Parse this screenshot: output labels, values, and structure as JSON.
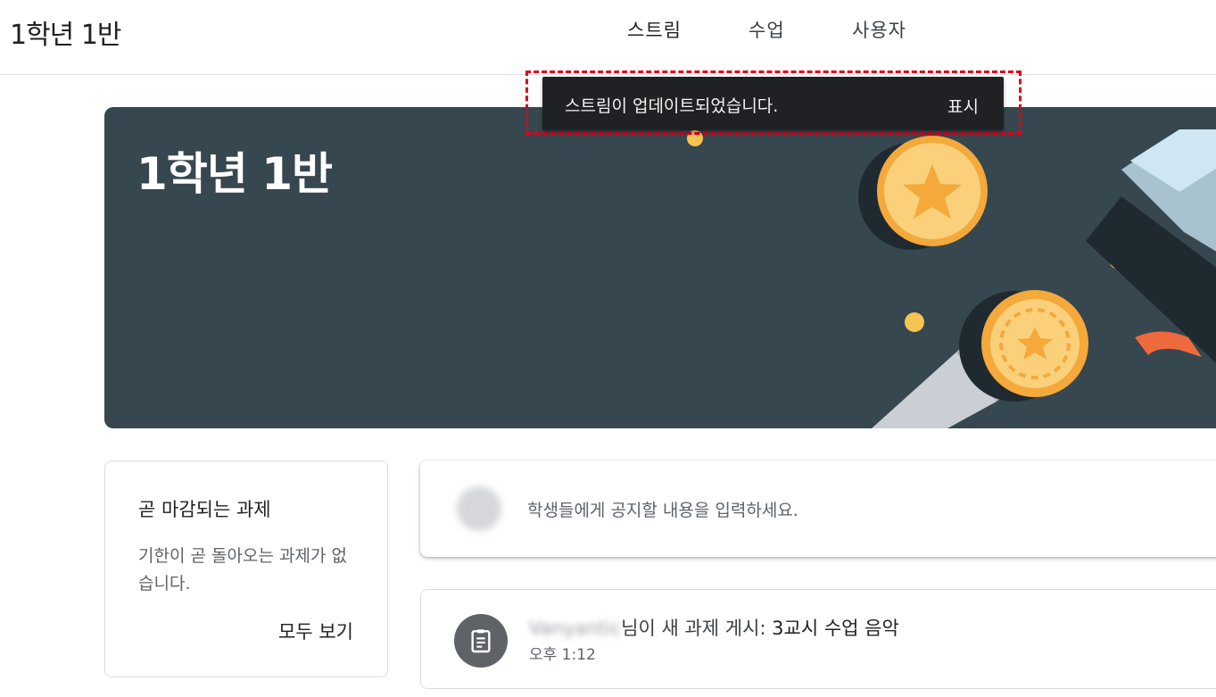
{
  "header": {
    "class_name": "1학년 1반",
    "tabs": [
      {
        "label": "스트림"
      },
      {
        "label": "수업"
      },
      {
        "label": "사용자"
      }
    ]
  },
  "snackbar": {
    "message": "스트림이 업데이트되었습니다.",
    "action": "표시"
  },
  "banner": {
    "title": "1학년 1반"
  },
  "upcoming": {
    "title": "곧 마감되는 과제",
    "empty_message": "기한이 곧 돌아오는 과제가 없습니다.",
    "view_all": "모두 보기"
  },
  "announce": {
    "placeholder": "학생들에게 공지할 내용을 입력하세요."
  },
  "post": {
    "author": "Vanyantic",
    "action_text": "님이 새 과제 게시: ",
    "title": "3교시 수업 음악",
    "time": "오후 1:12",
    "icon": "assignment-icon"
  },
  "colors": {
    "banner_bg": "#37474f",
    "snackbar_bg": "#202124",
    "highlight_outline": "#e0001b"
  }
}
